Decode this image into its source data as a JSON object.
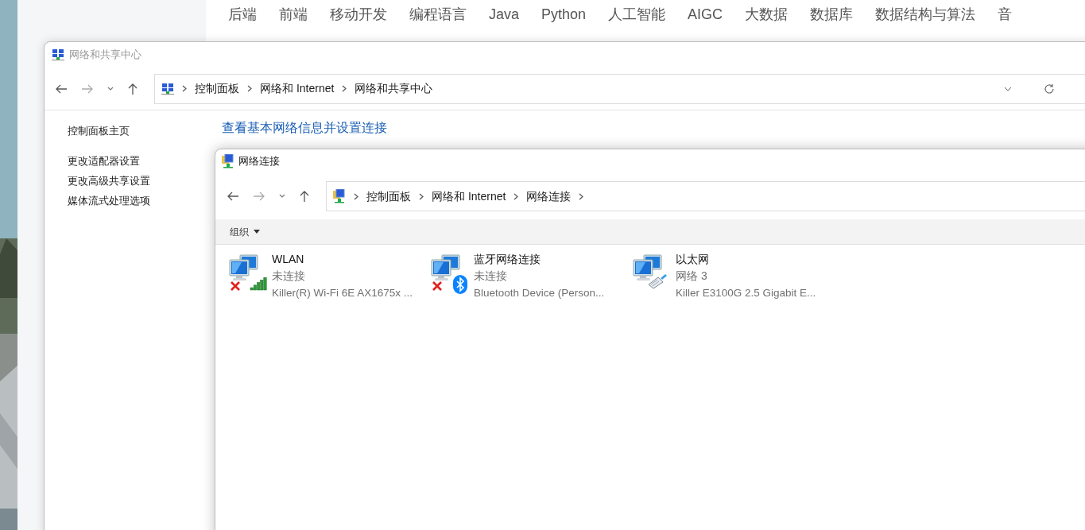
{
  "browser_nav": {
    "items": [
      "后端",
      "前端",
      "移动开发",
      "编程语言",
      "Java",
      "Python",
      "人工智能",
      "AIGC",
      "大数据",
      "数据库",
      "数据结构与算法",
      "音"
    ]
  },
  "sharing_center": {
    "title": "网络和共享中心",
    "breadcrumb": [
      "控制面板",
      "网络和 Internet",
      "网络和共享中心"
    ],
    "sidebar": {
      "items": [
        "控制面板主页",
        "更改适配器设置",
        "更改高级共享设置",
        "媒体流式处理选项"
      ]
    },
    "heading": "查看基本网络信息并设置连接"
  },
  "connections": {
    "title": "网络连接",
    "breadcrumb": [
      "控制面板",
      "网络和 Internet",
      "网络连接"
    ],
    "toolbar": {
      "organize": "组织"
    },
    "items": [
      {
        "kind": "wifi",
        "name": "WLAN",
        "status": "未连接",
        "device": "Killer(R) Wi-Fi 6E AX1675x ...",
        "disconnected": true
      },
      {
        "kind": "bluetooth",
        "name": "蓝牙网络连接",
        "status": "未连接",
        "device": "Bluetooth Device (Person...",
        "disconnected": true
      },
      {
        "kind": "ethernet",
        "name": "以太网",
        "status": "网络 3",
        "device": "Killer E3100G 2.5 Gigabit E...",
        "disconnected": false
      }
    ]
  }
}
